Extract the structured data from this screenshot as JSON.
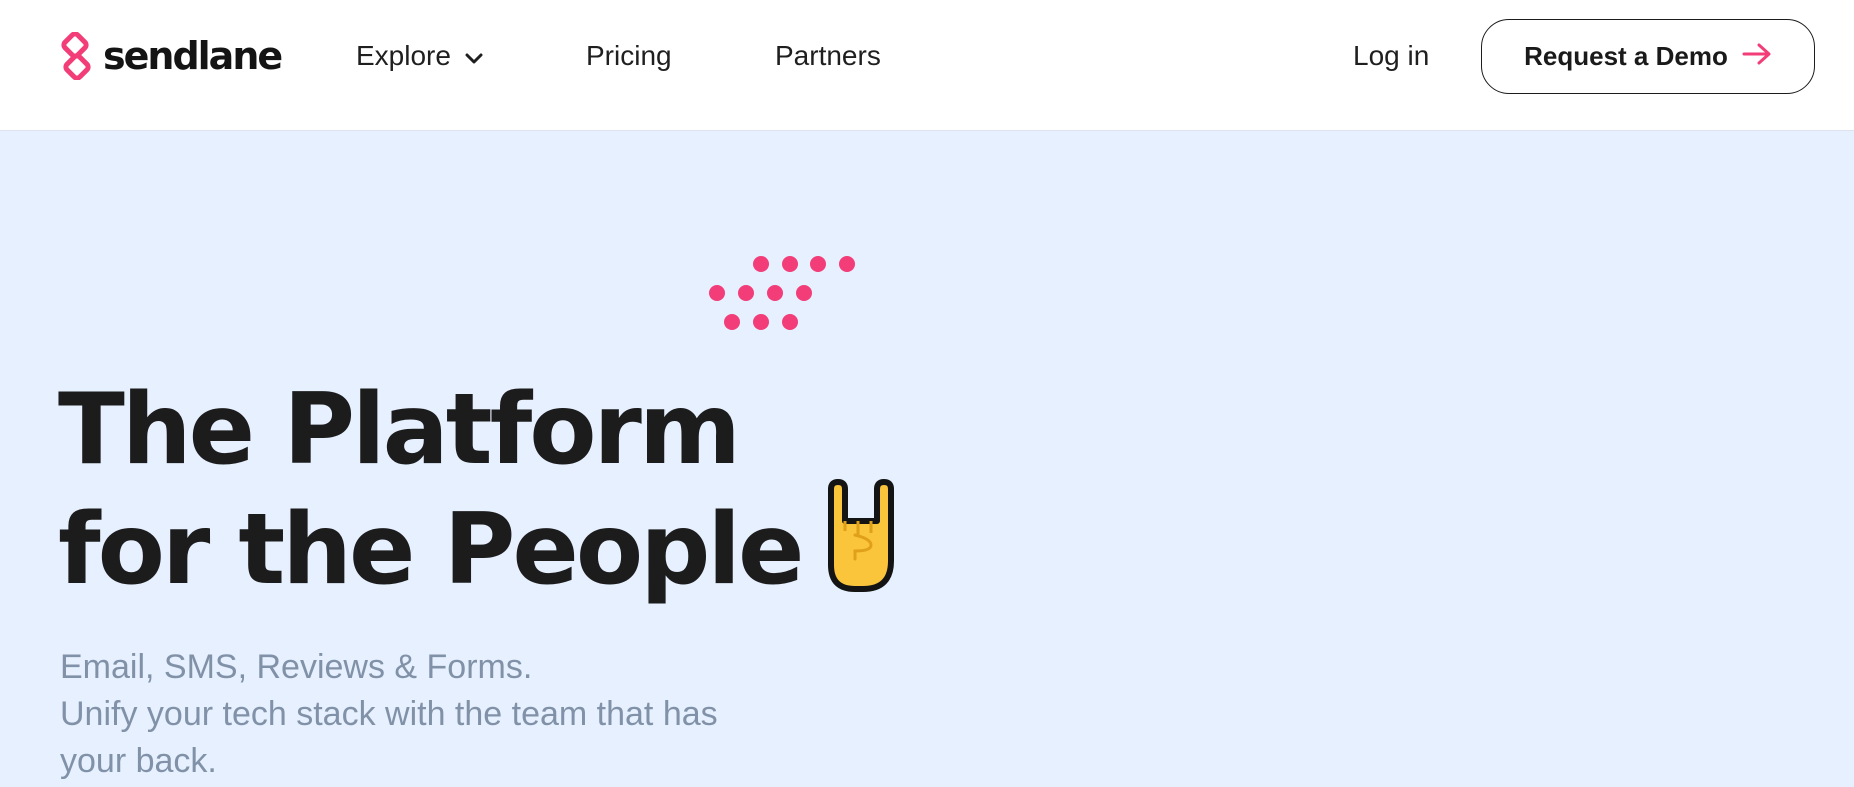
{
  "brand": {
    "name": "sendlane",
    "accent_color": "#f23d78",
    "logo_icon": "sendlane-logo-icon"
  },
  "nav": {
    "items": [
      {
        "label": "Explore",
        "icon": "chevron-down-icon"
      },
      {
        "label": "Pricing"
      },
      {
        "label": "Partners"
      }
    ],
    "login_label": "Log in",
    "cta_label": "Request a Demo",
    "cta_icon": "arrow-right-icon"
  },
  "hero": {
    "title_line1": "The Platform",
    "title_line2": "for the People",
    "title_emoji": "rock-on-hand-icon",
    "subtitle_lines": [
      "Email, SMS, Reviews & Forms.",
      "Unify your tech stack with the team that has",
      "your back."
    ],
    "background_color": "#e6f0fe",
    "subtitle_color": "#8192a8"
  }
}
